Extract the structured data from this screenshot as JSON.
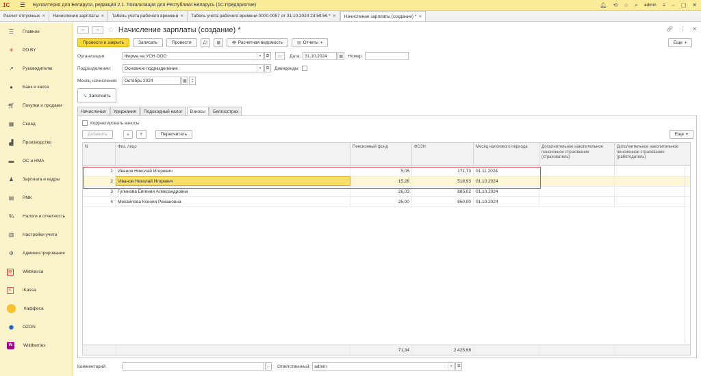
{
  "app": {
    "logo": "1С",
    "title": "Бухгалтерия для Беларуси, редакция 2.1. Локализация для Республики Беларусь  (1С:Предприятие)",
    "user": "admin"
  },
  "tabs": [
    {
      "label": "Расчет отпускных"
    },
    {
      "label": "Начисления зарплаты"
    },
    {
      "label": "Табель учета рабочего времени"
    },
    {
      "label": "Табель учета рабочего времени 0000-0057 от 31.10.2024 23:59:59 *"
    },
    {
      "label": "Начисление зарплаты (создание) *"
    }
  ],
  "sidebar": {
    "items": [
      {
        "label": "Главное",
        "icon": "menu-icon"
      },
      {
        "label": "РО.BY",
        "icon": "asterisk-icon"
      },
      {
        "label": "Руководителю",
        "icon": "trend-icon"
      },
      {
        "label": "Банк и касса",
        "icon": "coin-icon"
      },
      {
        "label": "Покупки и продажи",
        "icon": "cart-icon"
      },
      {
        "label": "Склад",
        "icon": "warehouse-icon"
      },
      {
        "label": "Производство",
        "icon": "factory-icon"
      },
      {
        "label": "ОС и НМА",
        "icon": "truck-icon"
      },
      {
        "label": "Зарплата и кадры",
        "icon": "person-icon"
      },
      {
        "label": "РМК",
        "icon": "register-icon"
      },
      {
        "label": "Налоги и отчетность",
        "icon": "percent-icon"
      },
      {
        "label": "Настройки учета",
        "icon": "book-icon"
      },
      {
        "label": "Администрирование",
        "icon": "gear-icon"
      },
      {
        "label": "Webkassa",
        "icon": "webkassa-icon"
      },
      {
        "label": "iKassa",
        "icon": "ikassa-icon"
      },
      {
        "label": "Каффеса",
        "icon": "sun-icon"
      },
      {
        "label": "OZON",
        "icon": "ozon-icon"
      },
      {
        "label": "Wildberries",
        "icon": "wildberries-icon"
      }
    ]
  },
  "document": {
    "title": "Начисление зарплаты (создание) *",
    "toolbar": {
      "post_close": "Провести и закрыть",
      "save": "Записать",
      "post": "Провести",
      "payslip": "Расчетная ведомость",
      "reports": "Отчеты",
      "more": "Еще"
    },
    "form": {
      "org_label": "Организация:",
      "org_value": "Фирма на УСН ООО",
      "date_label": "Дата:",
      "date_value": "31.10.2024",
      "number_label": "Номер:",
      "number_value": "",
      "dept_label": "Подразделение:",
      "dept_value": "Основное подразделение",
      "dividends_label": "Дивиденды:",
      "month_label": "Месяц начисления:",
      "month_value": "Октябрь 2024"
    },
    "fill_button": "Заполнить",
    "inner_tabs": [
      "Начисления",
      "Удержания",
      "Подоходный налог",
      "Взносы",
      "Белгосстрах"
    ],
    "active_inner_tab": "Взносы",
    "contributions": {
      "adjust_label": "Корректировать взносы",
      "add_button": "Добавить",
      "recalc_button": "Пересчитать",
      "more": "Еще",
      "columns": [
        "N",
        "Физ. лицо",
        "Пенсионный фонд",
        "ФСЗН",
        "Месяц налогового периода",
        "Дополнительное накопительное пенсионное страхование (страхователь)",
        "Дополнительное накопительное пенсионное страхование (работодатель)"
      ],
      "rows": [
        {
          "n": "1",
          "person": "Иванов Николай Игоревич",
          "pension": "5,05",
          "fszn": "171,73",
          "month": "01.11.2024"
        },
        {
          "n": "2",
          "person": "Иванов Николай Игоревич",
          "pension": "15,26",
          "fszn": "518,93",
          "month": "01.10.2024"
        },
        {
          "n": "3",
          "person": "Гулинова Евгения Александровна",
          "pension": "26,03",
          "fszn": "885,02",
          "month": "01.10.2024"
        },
        {
          "n": "4",
          "person": "Михайлова Ксения Романовна",
          "pension": "25,00",
          "fszn": "850,00",
          "month": "01.10.2024"
        }
      ],
      "totals": {
        "pension": "71,34",
        "fszn": "2 425,68"
      }
    },
    "footer": {
      "comment_label": "Комментарий:",
      "comment_value": "",
      "responsible_label": "Ответственный:",
      "responsible_value": "admin"
    }
  }
}
